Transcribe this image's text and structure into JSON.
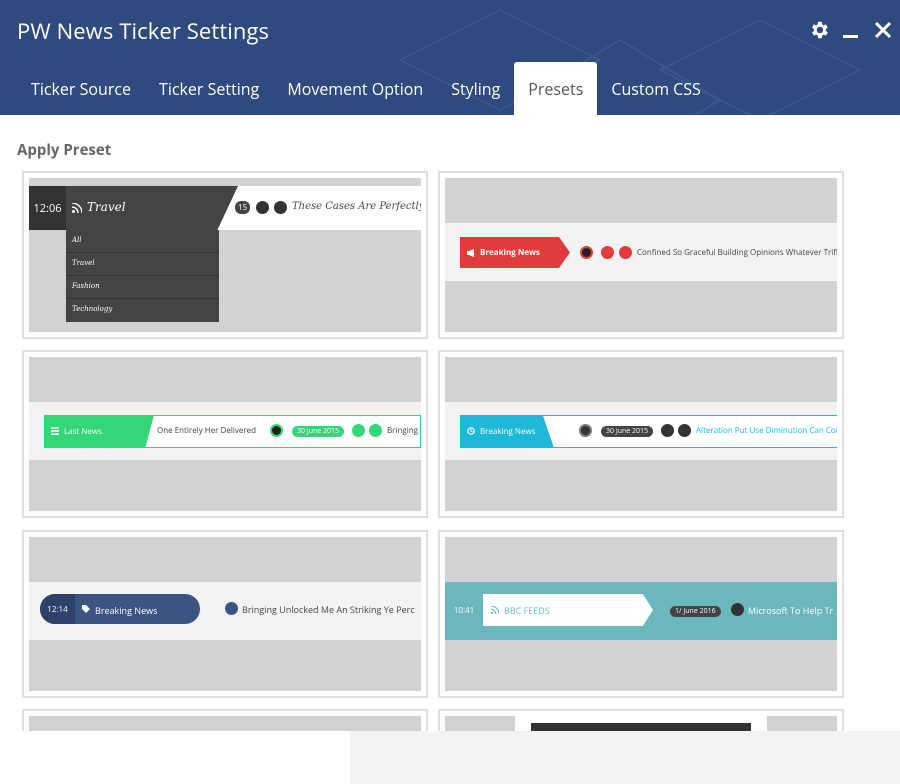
{
  "window": {
    "title": "PW News Ticker Settings"
  },
  "tabs": [
    "Ticker Source",
    "Ticker Setting",
    "Movement Option",
    "Styling",
    "Presets",
    "Custom CSS"
  ],
  "section_title": "Apply Preset",
  "presets": {
    "p1": {
      "time": "12:06",
      "category": "Travel",
      "count": "15",
      "headline": "These Cases Are Perfectly Simp",
      "menu": [
        "All",
        "Travel",
        "Fashion",
        "Technology"
      ]
    },
    "p2": {
      "label": "Breaking News",
      "headline": "Confined So Graceful Building Opinions Whatever Trifl"
    },
    "p3": {
      "label": "Last News",
      "text": "One Entirely Her Delivered",
      "date": "30 June 2015",
      "headline": "Bringing"
    },
    "p4": {
      "label": "Breaking News",
      "date": "30 June 2015",
      "headline": "Alteration Put Use Diminution Can Cor"
    },
    "p5": {
      "time": "12:14",
      "label": "Breaking News",
      "headline": "Bringing Unlocked Me An Striking Ye Perc"
    },
    "p6": {
      "time": "10:41",
      "label": "BBC FEEDS",
      "date": "1/ June 2016",
      "headline": "Microsoft To Help Tr"
    }
  },
  "colors": {
    "header": "#2f4a7e",
    "preset_red": "#e23b3b",
    "preset_green": "#35d677",
    "preset_cyan": "#1fb8d8",
    "preset_navy": "#3c5483",
    "preset_teal": "#6bb7bc"
  }
}
